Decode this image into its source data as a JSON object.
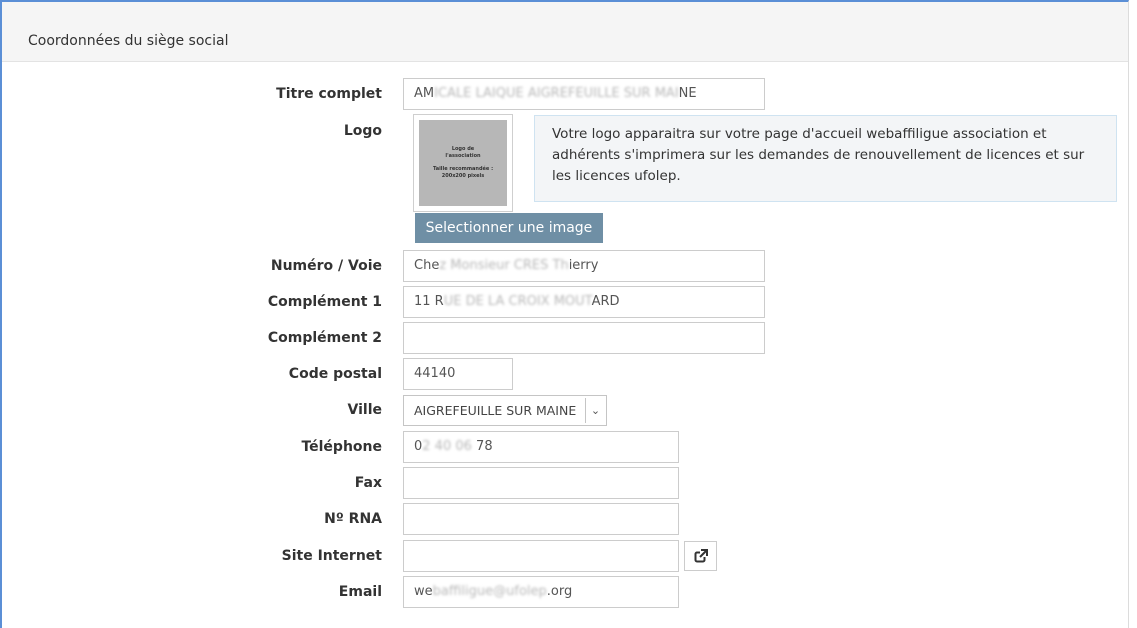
{
  "section": {
    "title": "Coordonnées du siège social"
  },
  "fields": {
    "titre": {
      "label": "Titre complet",
      "value_start": "AM",
      "value_blur": "ICALE LAIQUE AIGREFEUILLE SUR MAI",
      "value_end": "NE"
    },
    "logo": {
      "label": "Logo",
      "thumb_line1": "Logo de",
      "thumb_line2": "l'association",
      "thumb_line3": "Taille recommandée :",
      "thumb_line4": "200x200 pixels",
      "info": "Votre logo apparaitra sur votre page d'accueil webaffiligue association et adhérents s'imprimera sur les demandes de renouvellement de licences et sur les licences ufolep.",
      "button": "Selectionner une image"
    },
    "numero_voie": {
      "label": "Numéro / Voie",
      "value_start": "Che",
      "value_blur": "z Monsieur CRES Th",
      "value_end": "ierry"
    },
    "complement1": {
      "label": "Complément 1",
      "value_start": "11 R",
      "value_blur": "UE DE LA CROIX MOUT",
      "value_end": "ARD"
    },
    "complement2": {
      "label": "Complément 2",
      "value": ""
    },
    "code_postal": {
      "label": "Code postal",
      "value": "44140"
    },
    "ville": {
      "label": "Ville",
      "value": "AIGREFEUILLE SUR MAINE",
      "caret_icon": "chevron-down-icon"
    },
    "telephone": {
      "label": "Téléphone",
      "value_start": "0",
      "value_blur": "2 40 06 ",
      "value_end": "78"
    },
    "fax": {
      "label": "Fax",
      "value": ""
    },
    "rna": {
      "label": "Nº RNA",
      "value": ""
    },
    "site": {
      "label": "Site Internet",
      "value": "",
      "icon": "external-link-icon"
    },
    "email": {
      "label": "Email",
      "value_start": "we",
      "value_blur": "baffiligue@ufolep",
      "value_end": ".org"
    }
  },
  "colors": {
    "accent": "#5b8fd6",
    "button": "#6f8fa5",
    "info_bg": "#f3f5f7"
  }
}
